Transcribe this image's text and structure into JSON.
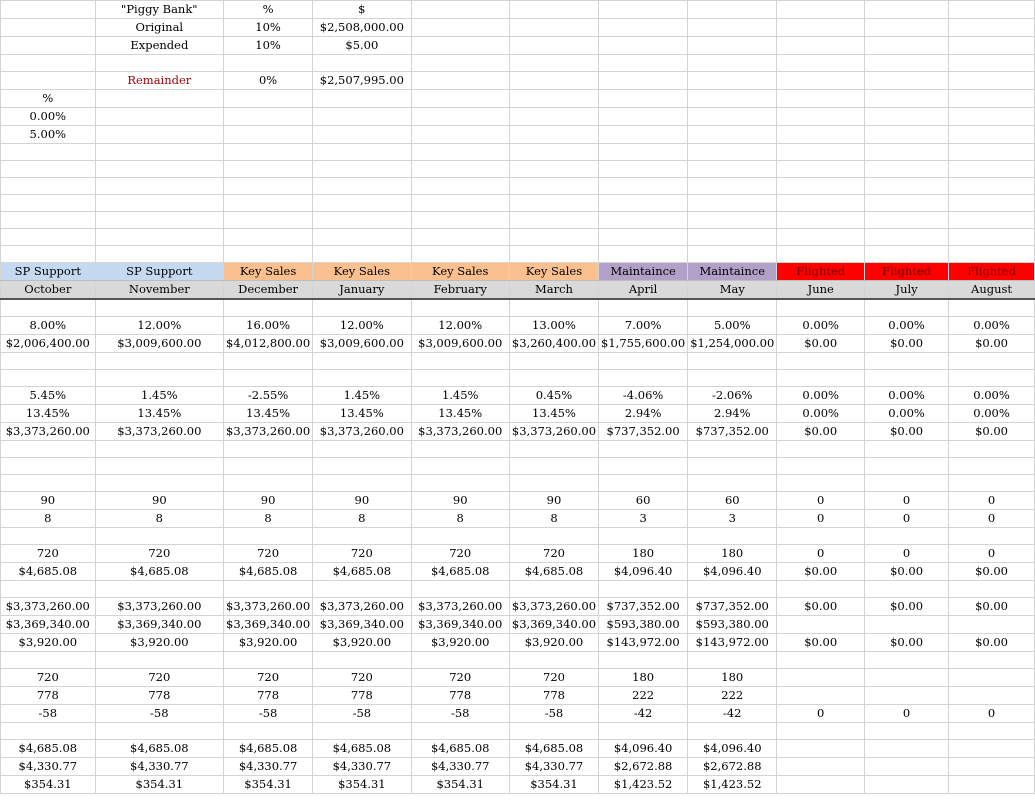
{
  "colors": {
    "sp_support": "#c5d9f1",
    "key_sales": "#fac090",
    "maintaince": "#b1a0c7",
    "flighted": "#ff0000",
    "month_row": "#d9d9d9",
    "remainder_text": "#9c0006"
  },
  "rows": [
    [
      "",
      "\"Piggy Bank\"",
      "%",
      "$",
      "",
      "",
      "",
      "",
      "",
      "",
      ""
    ],
    [
      "",
      "Original",
      "10%",
      "$2,508,000.00",
      "",
      "",
      "",
      "",
      "",
      "",
      ""
    ],
    [
      "",
      "Expended",
      "10%",
      "$5.00",
      "",
      "",
      "",
      "",
      "",
      "",
      ""
    ],
    [
      "",
      "",
      "",
      "",
      "",
      "",
      "",
      "",
      "",
      "",
      ""
    ],
    [
      "",
      "Remainder",
      "0%",
      "$2,507,995.00",
      "",
      "",
      "",
      "",
      "",
      "",
      ""
    ],
    [
      "%",
      "",
      "",
      "",
      "",
      "",
      "",
      "",
      "",
      "",
      ""
    ],
    [
      "0.00%",
      "",
      "",
      "",
      "",
      "",
      "",
      "",
      "",
      "",
      ""
    ],
    [
      "5.00%",
      "",
      "",
      "",
      "",
      "",
      "",
      "",
      "",
      "",
      ""
    ],
    [
      "",
      "",
      "",
      "",
      "",
      "",
      "",
      "",
      "",
      "",
      ""
    ],
    [
      "",
      "",
      "",
      "",
      "",
      "",
      "",
      "",
      "",
      "",
      ""
    ],
    [
      "",
      "",
      "",
      "",
      "",
      "",
      "",
      "",
      "",
      "",
      ""
    ],
    [
      "",
      "",
      "",
      "",
      "",
      "",
      "",
      "",
      "",
      "",
      ""
    ],
    [
      "",
      "",
      "",
      "",
      "",
      "",
      "",
      "",
      "",
      "",
      ""
    ],
    [
      "",
      "",
      "",
      "",
      "",
      "",
      "",
      "",
      "",
      "",
      ""
    ],
    [
      "",
      "",
      "",
      "",
      "",
      "",
      "",
      "",
      "",
      "",
      ""
    ],
    [
      "SP Support",
      "SP Support",
      "Key Sales",
      "Key Sales",
      "Key Sales",
      "Key Sales",
      "Maintaince",
      "Maintaince",
      "Flighted",
      "Flighted",
      "Flighted"
    ],
    [
      "October",
      "November",
      "December",
      "January",
      "February",
      "March",
      "April",
      "May",
      "June",
      "July",
      "August"
    ],
    [
      "",
      "",
      "",
      "",
      "",
      "",
      "",
      "",
      "",
      "",
      ""
    ],
    [
      "8.00%",
      "12.00%",
      "16.00%",
      "12.00%",
      "12.00%",
      "13.00%",
      "7.00%",
      "5.00%",
      "0.00%",
      "0.00%",
      "0.00%"
    ],
    [
      "$2,006,400.00",
      "$3,009,600.00",
      "$4,012,800.00",
      "$3,009,600.00",
      "$3,009,600.00",
      "$3,260,400.00",
      "$1,755,600.00",
      "$1,254,000.00",
      "$0.00",
      "$0.00",
      "$0.00"
    ],
    [
      "",
      "",
      "",
      "",
      "",
      "",
      "",
      "",
      "",
      "",
      ""
    ],
    [
      "",
      "",
      "",
      "",
      "",
      "",
      "",
      "",
      "",
      "",
      ""
    ],
    [
      "5.45%",
      "1.45%",
      "-2.55%",
      "1.45%",
      "1.45%",
      "0.45%",
      "-4.06%",
      "-2.06%",
      "0.00%",
      "0.00%",
      "0.00%"
    ],
    [
      "13.45%",
      "13.45%",
      "13.45%",
      "13.45%",
      "13.45%",
      "13.45%",
      "2.94%",
      "2.94%",
      "0.00%",
      "0.00%",
      "0.00%"
    ],
    [
      "$3,373,260.00",
      "$3,373,260.00",
      "$3,373,260.00",
      "$3,373,260.00",
      "$3,373,260.00",
      "$3,373,260.00",
      "$737,352.00",
      "$737,352.00",
      "$0.00",
      "$0.00",
      "$0.00"
    ],
    [
      "",
      "",
      "",
      "",
      "",
      "",
      "",
      "",
      "",
      "",
      ""
    ],
    [
      "",
      "",
      "",
      "",
      "",
      "",
      "",
      "",
      "",
      "",
      ""
    ],
    [
      "",
      "",
      "",
      "",
      "",
      "",
      "",
      "",
      "",
      "",
      ""
    ],
    [
      "90",
      "90",
      "90",
      "90",
      "90",
      "90",
      "60",
      "60",
      "0",
      "0",
      "0"
    ],
    [
      "8",
      "8",
      "8",
      "8",
      "8",
      "8",
      "3",
      "3",
      "0",
      "0",
      "0"
    ],
    [
      "",
      "",
      "",
      "",
      "",
      "",
      "",
      "",
      "",
      "",
      ""
    ],
    [
      "720",
      "720",
      "720",
      "720",
      "720",
      "720",
      "180",
      "180",
      "0",
      "0",
      "0"
    ],
    [
      "$4,685.08",
      "$4,685.08",
      "$4,685.08",
      "$4,685.08",
      "$4,685.08",
      "$4,685.08",
      "$4,096.40",
      "$4,096.40",
      "$0.00",
      "$0.00",
      "$0.00"
    ],
    [
      "",
      "",
      "",
      "",
      "",
      "",
      "",
      "",
      "",
      "",
      ""
    ],
    [
      "$3,373,260.00",
      "$3,373,260.00",
      "$3,373,260.00",
      "$3,373,260.00",
      "$3,373,260.00",
      "$3,373,260.00",
      "$737,352.00",
      "$737,352.00",
      "$0.00",
      "$0.00",
      "$0.00"
    ],
    [
      "$3,369,340.00",
      "$3,369,340.00",
      "$3,369,340.00",
      "$3,369,340.00",
      "$3,369,340.00",
      "$3,369,340.00",
      "$593,380.00",
      "$593,380.00",
      "",
      "",
      ""
    ],
    [
      "$3,920.00",
      "$3,920.00",
      "$3,920.00",
      "$3,920.00",
      "$3,920.00",
      "$3,920.00",
      "$143,972.00",
      "$143,972.00",
      "$0.00",
      "$0.00",
      "$0.00"
    ],
    [
      "",
      "",
      "",
      "",
      "",
      "",
      "",
      "",
      "",
      "",
      ""
    ],
    [
      "720",
      "720",
      "720",
      "720",
      "720",
      "720",
      "180",
      "180",
      "",
      "",
      ""
    ],
    [
      "778",
      "778",
      "778",
      "778",
      "778",
      "778",
      "222",
      "222",
      "",
      "",
      ""
    ],
    [
      "-58",
      "-58",
      "-58",
      "-58",
      "-58",
      "-58",
      "-42",
      "-42",
      "0",
      "0",
      "0"
    ],
    [
      "",
      "",
      "",
      "",
      "",
      "",
      "",
      "",
      "",
      "",
      ""
    ],
    [
      "$4,685.08",
      "$4,685.08",
      "$4,685.08",
      "$4,685.08",
      "$4,685.08",
      "$4,685.08",
      "$4,096.40",
      "$4,096.40",
      "",
      "",
      ""
    ],
    [
      "$4,330.77",
      "$4,330.77",
      "$4,330.77",
      "$4,330.77",
      "$4,330.77",
      "$4,330.77",
      "$2,672.88",
      "$2,672.88",
      "",
      "",
      ""
    ],
    [
      "$354.31",
      "$354.31",
      "$354.31",
      "$354.31",
      "$354.31",
      "$354.31",
      "$1,423.52",
      "$1,423.52",
      "",
      "",
      ""
    ]
  ]
}
